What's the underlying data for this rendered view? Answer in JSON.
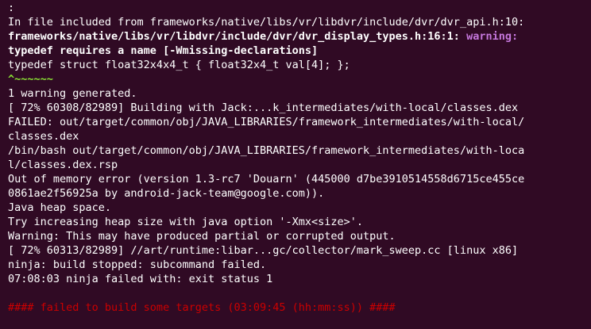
{
  "terminal": {
    "colors": {
      "background": "#300a24",
      "foreground": "#ffffff",
      "warning": "#c678dd",
      "caret": "#8ae234",
      "error": "#cc0000"
    },
    "lines": {
      "l0": ":",
      "l1": "In file included from frameworks/native/libs/vr/libdvr/include/dvr/dvr_api.h:10:",
      "l2_path": "frameworks/native/libs/vr/libdvr/include/dvr/dvr_display_types.h:16:1:",
      "l2_warn": "warning:",
      "l3": "typedef requires a name [-Wmissing-declarations]",
      "l4": "typedef struct float32x4x4_t { float32x4_t val[4]; };",
      "l5": "^~~~~~~",
      "l6": "1 warning generated.",
      "l7": "[ 72% 60308/82989] Building with Jack:...k_intermediates/with-local/classes.dex",
      "l8": "FAILED: out/target/common/obj/JAVA_LIBRARIES/framework_intermediates/with-local/",
      "l9": "classes.dex",
      "l10": "/bin/bash out/target/common/obj/JAVA_LIBRARIES/framework_intermediates/with-loca",
      "l11": "l/classes.dex.rsp",
      "l12": "Out of memory error (version 1.3-rc7 'Douarn' (445000 d7be3910514558d6715ce455ce",
      "l13": "0861ae2f56925a by android-jack-team@google.com)).",
      "l14": "Java heap space.",
      "l15": "Try increasing heap size with java option '-Xmx<size>'.",
      "l16": "Warning: This may have produced partial or corrupted output.",
      "l17": "[ 72% 60313/82989] //art/runtime:libar...gc/collector/mark_sweep.cc [linux x86]",
      "l18": "ninja: build stopped: subcommand failed.",
      "l19": "07:08:03 ninja failed with: exit status 1",
      "l21": "#### failed to build some targets (03:09:45 (hh:mm:ss)) ####"
    }
  }
}
